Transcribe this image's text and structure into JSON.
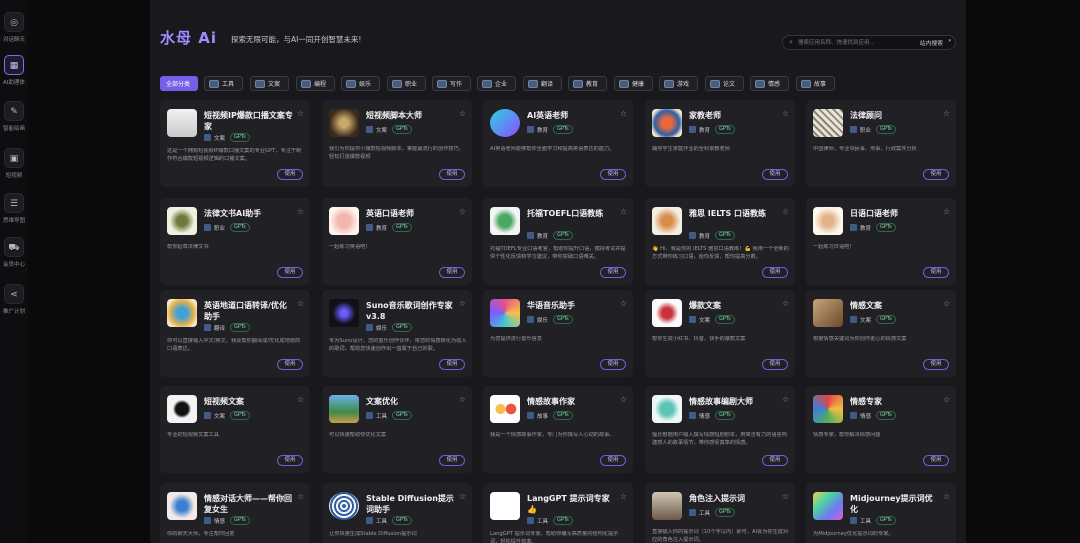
{
  "sidebar": {
    "items": [
      {
        "label": "对话聊天",
        "icon": "chat-icon",
        "glyph": "◎"
      },
      {
        "label": "AI助理体",
        "icon": "grid-icon",
        "glyph": "▦"
      },
      {
        "label": "智能绘画",
        "icon": "brush-icon",
        "glyph": "✎"
      },
      {
        "label": "短视频",
        "icon": "video-icon",
        "glyph": "▣"
      },
      {
        "label": "思维导图",
        "icon": "mindmap-icon",
        "glyph": "☰"
      },
      {
        "label": "会员中心",
        "icon": "cart-icon",
        "glyph": "⛟"
      },
      {
        "label": "推广计划",
        "icon": "share-icon",
        "glyph": "⋖"
      }
    ]
  },
  "header": {
    "brand": "水母 Ai",
    "slogan": "探索无限可能，与AI一同开创智慧未来!",
    "search_placeholder": "搜索应用名称、快速找到应用...",
    "search_scope": "站内搜索"
  },
  "tabs": [
    "全部分类",
    "工具",
    "文案",
    "编程",
    "娱乐",
    "职业",
    "写作",
    "企业",
    "翻译",
    "教育",
    "健康",
    "游戏",
    "论文",
    "情感",
    "故事"
  ],
  "use_label": "使用",
  "gpts_label": "GPTs",
  "cards": [
    {
      "title": "短视频IP爆款口播文案专家",
      "category": "文案",
      "desc": "这是一个拥有短视频IP爆款口播文案的专业GPT，专注于制作符合爆款短视频逻辑的口播文案。",
      "avatar": "person-avatar"
    },
    {
      "title": "短视频脚本大师",
      "category": "文案",
      "desc": "我们为你提供小爆款短视频脚本，掌握最流行的创作技巧，轻松打造爆款视频",
      "avatar": "art-avatar"
    },
    {
      "title": "AI英语老师",
      "category": "教育",
      "desc": "AI英语老师能够帮你全面学习和提高英语表达的能力。",
      "avatar": "c-logo-avatar"
    },
    {
      "title": "家教老师",
      "category": "教育",
      "desc": "辅导学生家庭作业的全科家教老师",
      "avatar": "owl-avatar"
    },
    {
      "title": "法律顾问",
      "category": "职业",
      "desc": "中国律师，专业领民事、刑事、行政案件分析",
      "avatar": "lawyer-avatar"
    },
    {
      "title": "法律文书AI助手",
      "category": "职业",
      "desc": "帮你起草法律文书",
      "avatar": "pattern-avatar"
    },
    {
      "title": "英语口语老师",
      "category": "教育",
      "desc": "一起练习英语吧！",
      "avatar": "cat-avatar"
    },
    {
      "title": "托福TOEFL口语教练",
      "category": "教育",
      "desc": "托福TOEFL专业口语考官，帮助你提升口语，模拟考试并提供个性化反馈和学习建议，带你突破口语难关。",
      "avatar": "turtle-avatar"
    },
    {
      "title": "雅思 IELTS 口语教练",
      "category": "教育",
      "desc": "👋 Hi，我是你的 IELTS 雅思口语教练！💪 我用一个全新的方式带你练习口语，给你反馈，帮你提高分数。",
      "avatar": "fox-avatar"
    },
    {
      "title": "日语口语老师",
      "category": "教育",
      "desc": "一起练习日语吧！",
      "avatar": "kitty-avatar"
    },
    {
      "title": "英语地道口语转译/优化助手",
      "category": "翻译",
      "desc": "你可以直接输入中文/英文，我会帮你翻译成/优化成地道的口语表达。",
      "avatar": "globe-avatar"
    },
    {
      "title": "Suno音乐歌词创作专家v3.8",
      "category": "娱乐",
      "desc": "专为Suno设计，您的音乐创作伙伴，将您的情感转化为动人的歌词，帮助您快速创作出一首属于自己的歌。",
      "avatar": "orb-avatar"
    },
    {
      "title": "华语音乐助手",
      "category": "娱乐",
      "desc": "为您提供流行音乐信息",
      "avatar": "swirl-avatar"
    },
    {
      "title": "爆款文案",
      "category": "文案",
      "desc": "帮你生成小红书、抖音、快手的爆款文案",
      "avatar": "book-avatar"
    },
    {
      "title": "情感文案",
      "category": "文案",
      "desc": "根据情感关键词为你创作走心的情感文案",
      "avatar": "collage-avatar"
    },
    {
      "title": "短视频文案",
      "category": "文案",
      "desc": "专业的短视频文案工具",
      "avatar": "camera-avatar"
    },
    {
      "title": "文案优化",
      "category": "工具",
      "desc": "可以快速帮助你优化文案",
      "avatar": "landscape-avatar"
    },
    {
      "title": "情感故事作家",
      "category": "故事",
      "desc": "我是一个情感故事作家，专门为你撰写人心动的故事。",
      "avatar": "emoji-avatar"
    },
    {
      "title": "情感故事编剧大师",
      "category": "情感",
      "desc": "擅长根据用户输入撰写情感短剧剧本，用简洁有力的语言构建感人的故事情节，带你感受真挚的情感。",
      "avatar": "chat-bubble-avatar"
    },
    {
      "title": "情感专家",
      "category": "情感",
      "desc": "情感专家，帮你解决情感问题",
      "avatar": "heart-avatar"
    },
    {
      "title": "情感对话大师——帮你回复女生",
      "category": "情感",
      "desc": "你的聊天大师，专注帮你回复",
      "avatar": "girl-avatar"
    },
    {
      "title": "Stable Diffusion提示词助手",
      "category": "工具",
      "desc": "让你快速生成Stable Diffusion提示词",
      "avatar": "mandala-avatar"
    },
    {
      "title": "LangGPT 提示词专家👍",
      "category": "工具",
      "desc": "LangGPT 提示词专家，帮助你编写高质量的结构化提示词，轻松提升效率。",
      "avatar": "langgpt-avatar"
    },
    {
      "title": "角色注入提示词",
      "category": "工具",
      "desc": "直接输入你的提示词（10个字以内）即可，AI会为你生成对应的角色注入提示词。",
      "avatar": "robot-avatar"
    },
    {
      "title": "Midjourney提示词优化",
      "category": "工具",
      "desc": "为Midjourney优化提示词的专家。",
      "avatar": "gradient-avatar"
    }
  ]
}
